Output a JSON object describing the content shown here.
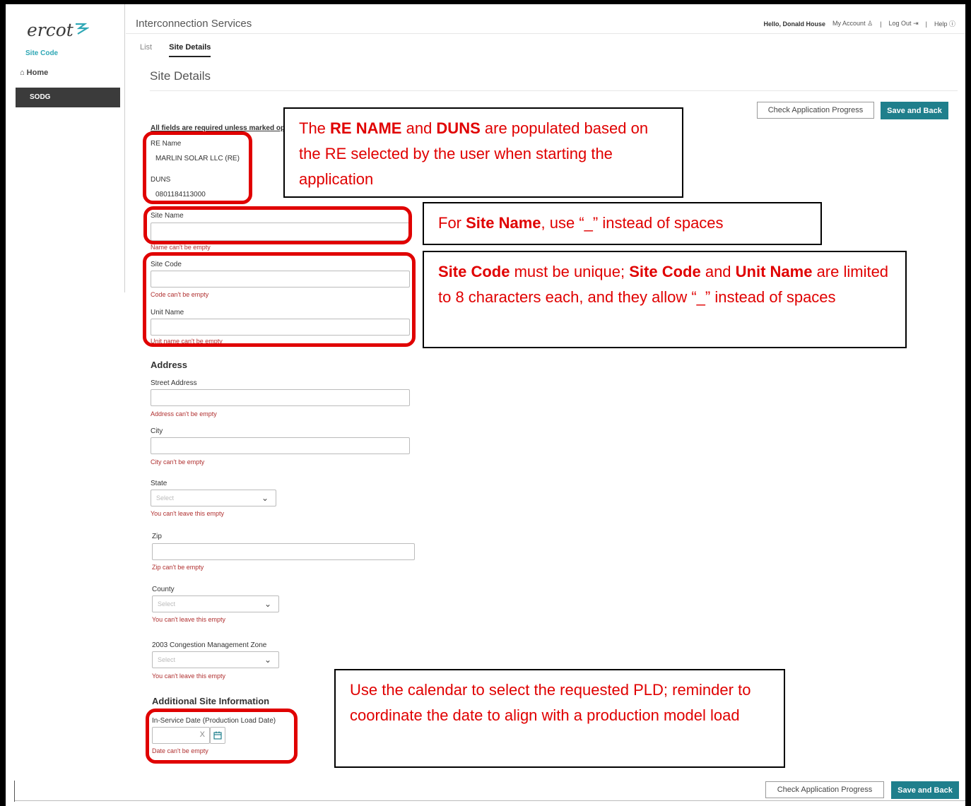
{
  "sidebar": {
    "logo_text": "ercot",
    "site_code_label": "Site Code",
    "home_label": "Home",
    "nav_item": "SODG"
  },
  "header": {
    "app_title": "Interconnection Services",
    "greeting": "Hello, Donald House",
    "my_account": "My Account",
    "log_out": "Log Out",
    "help": "Help",
    "sep": "|"
  },
  "tabs": [
    "List",
    "Site Details"
  ],
  "page": {
    "title": "Site Details",
    "check_progress": "Check Application Progress",
    "save_back": "Save and Back",
    "required_note": "All fields are required unless marked opt"
  },
  "form": {
    "re_name_label": "RE Name",
    "re_name_value": "MARLIN SOLAR LLC (RE)",
    "duns_label": "DUNS",
    "duns_value": "0801184113000",
    "site_name_label": "Site Name",
    "site_name_error": "Name can't be empty",
    "site_code_label": "Site Code",
    "site_code_error": "Code can't be empty",
    "unit_name_label": "Unit Name",
    "unit_name_error": "Unit name can't be empty",
    "address_heading": "Address",
    "street_label": "Street Address",
    "street_error": "Address can't be empty",
    "city_label": "City",
    "city_error": "City can't be empty",
    "state_label": "State",
    "state_placeholder": "Select",
    "state_error": "You can't leave this empty",
    "zip_label": "Zip",
    "zip_error": "Zip can't be empty",
    "county_label": "County",
    "county_placeholder": "Select",
    "county_error": "You can't leave this empty",
    "cmz_label": "2003 Congestion Management Zone",
    "cmz_placeholder": "Select",
    "cmz_error": "You can't leave this empty",
    "additional_heading": "Additional Site Information",
    "isd_label": "In-Service Date (Production Load Date)",
    "isd_clear": "X",
    "isd_error": "Date can't be empty"
  },
  "callouts": {
    "c1_a": "The ",
    "c1_b": "RE NAME",
    "c1_c": " and ",
    "c1_d": "DUNS",
    "c1_e": " are populated based on the RE selected by the user when starting the application",
    "c2_a": "For ",
    "c2_b": "Site Name",
    "c2_c": ", use “_” instead of spaces",
    "c3_a": "Site Code",
    "c3_b": " must be unique; ",
    "c3_c": "Site Code",
    "c3_d": " and ",
    "c3_e": "Unit Name",
    "c3_f": " are limited to 8 characters each, and they allow “_” instead of spaces",
    "c4": "Use the calendar to select the requested PLD; reminder to coordinate the date to align with a production model load"
  },
  "colors": {
    "accent": "#1f7f8c",
    "highlight": "#e00000",
    "error": "#b03030",
    "nav_bg": "#3b3b3b",
    "brand": "#2ea7b5"
  }
}
